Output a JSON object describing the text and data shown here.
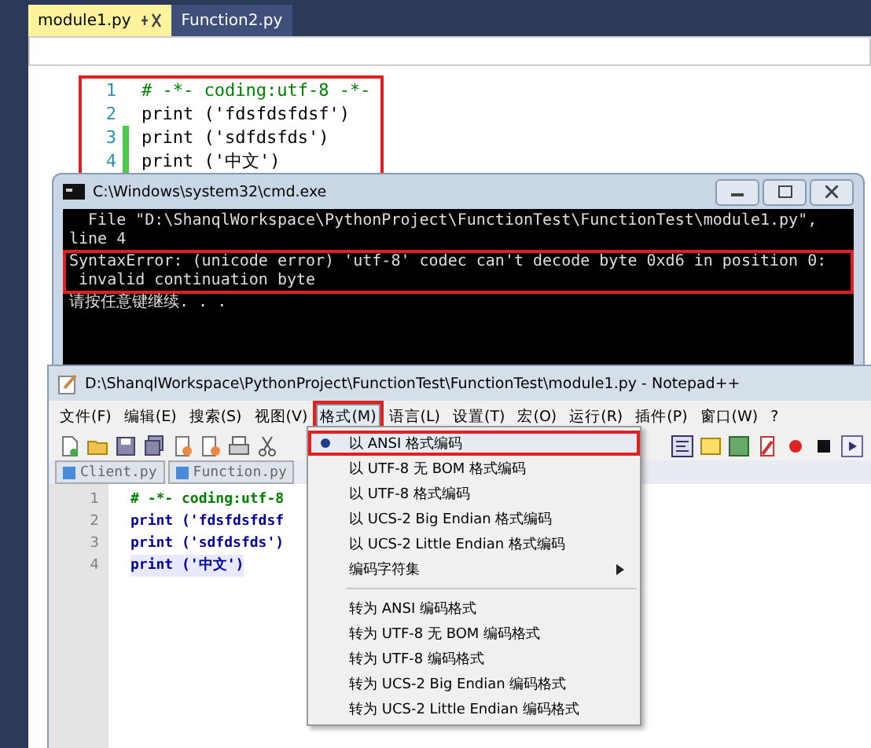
{
  "vs_editor": {
    "tabs": [
      {
        "label": "module1.py",
        "selected": true
      },
      {
        "label": "Function2.py",
        "selected": false
      }
    ],
    "highlighted": true,
    "code_lines": [
      {
        "number": "1",
        "changed": false,
        "kind": "comment",
        "text": "# -*- coding:utf-8 -*-"
      },
      {
        "number": "2",
        "changed": false,
        "kind": "code",
        "text": "print ('fdsfdsfdsf')"
      },
      {
        "number": "3",
        "changed": true,
        "kind": "code",
        "text": "print ('sdfdsfds')"
      },
      {
        "number": "4",
        "changed": true,
        "kind": "code",
        "text": "print ('中文')"
      }
    ]
  },
  "cmd_window": {
    "title": "C:\\Windows\\system32\\cmd.exe",
    "lines": [
      {
        "text": "  File \"D:\\ShanqlWorkspace\\PythonProject\\FunctionTest\\FunctionTest\\module1.py\",",
        "highlighted": false
      },
      {
        "text": "line 4",
        "highlighted": false
      },
      {
        "text": "SyntaxError: (unicode error) 'utf-8' codec can't decode byte 0xd6 in position 0:",
        "highlighted": true
      },
      {
        "text": " invalid continuation byte",
        "highlighted": true
      },
      {
        "text": "请按任意键继续. . .",
        "highlighted": false
      }
    ]
  },
  "notepad": {
    "title": "D:\\ShanqlWorkspace\\PythonProject\\FunctionTest\\FunctionTest\\module1.py - Notepad++",
    "menu": [
      {
        "label": "文件(F)",
        "selected": false
      },
      {
        "label": "编辑(E)",
        "selected": false
      },
      {
        "label": "搜索(S)",
        "selected": false
      },
      {
        "label": "视图(V)",
        "selected": false
      },
      {
        "label": "格式(M)",
        "selected": true
      },
      {
        "label": "语言(L)",
        "selected": false
      },
      {
        "label": "设置(T)",
        "selected": false
      },
      {
        "label": "宏(O)",
        "selected": false
      },
      {
        "label": "运行(R)",
        "selected": false
      },
      {
        "label": "插件(P)",
        "selected": false
      },
      {
        "label": "窗口(W)",
        "selected": false
      },
      {
        "label": "?",
        "selected": false
      }
    ],
    "tabs": [
      {
        "label": "Client.py",
        "selected": false
      },
      {
        "label": "Function.py",
        "selected": false
      }
    ],
    "code_lines": [
      {
        "number": "1",
        "kind": "comment",
        "current": false,
        "text": "# -*- coding:utf-8"
      },
      {
        "number": "2",
        "kind": "code",
        "current": false,
        "text": "print ('fdsfdsfdsf"
      },
      {
        "number": "3",
        "kind": "code",
        "current": false,
        "text": "print ('sdfdsfds')"
      },
      {
        "number": "4",
        "kind": "code",
        "current": true,
        "text": "print ('中文')"
      }
    ],
    "menu_highlighted": true,
    "format_menu": [
      {
        "kind": "item",
        "label": "以 ANSI 格式编码",
        "selected": true,
        "submenu": false
      },
      {
        "kind": "item",
        "label": "以 UTF-8 无 BOM 格式编码",
        "selected": false,
        "submenu": false
      },
      {
        "kind": "item",
        "label": "以 UTF-8 格式编码",
        "selected": false,
        "submenu": false
      },
      {
        "kind": "item",
        "label": "以 UCS-2 Big Endian 格式编码",
        "selected": false,
        "submenu": false
      },
      {
        "kind": "item",
        "label": "以 UCS-2 Little Endian 格式编码",
        "selected": false,
        "submenu": false
      },
      {
        "kind": "item",
        "label": "编码字符集",
        "selected": false,
        "submenu": true
      },
      {
        "kind": "separator"
      },
      {
        "kind": "item",
        "label": "转为 ANSI 编码格式",
        "selected": false,
        "submenu": false
      },
      {
        "kind": "item",
        "label": "转为 UTF-8 无 BOM 编码格式",
        "selected": false,
        "submenu": false
      },
      {
        "kind": "item",
        "label": "转为 UTF-8 编码格式",
        "selected": false,
        "submenu": false
      },
      {
        "kind": "item",
        "label": "转为 UCS-2 Big Endian 编码格式",
        "selected": false,
        "submenu": false
      },
      {
        "kind": "item",
        "label": "转为 UCS-2 Little Endian 编码格式",
        "selected": false,
        "submenu": false
      }
    ]
  }
}
